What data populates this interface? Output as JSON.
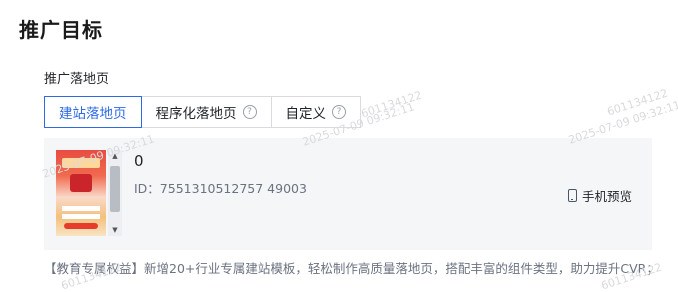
{
  "page": {
    "title": "推广目标"
  },
  "landing": {
    "label": "推广落地页",
    "tabs": [
      {
        "label": "建站落地页",
        "active": true,
        "help": false
      },
      {
        "label": "程序化落地页",
        "active": false,
        "help": true
      },
      {
        "label": "自定义",
        "active": false,
        "help": true
      }
    ],
    "selected": {
      "name": "0",
      "id_text": "ID：7551310512757 49003",
      "preview_label": "手机预览"
    },
    "description": "【教育专属权益】新增20+行业专属建站模板，轻松制作高质量落地页，搭配丰富的组件类型，助力提升CVR；"
  },
  "watermark": {
    "user": "601134122",
    "time": "2025-07-09 09:32:11"
  },
  "icons": {
    "help": "question-circle-icon",
    "phone": "mobile-phone-icon"
  },
  "colors": {
    "accent": "#2e6ae6",
    "card_bg": "#f5f6f8",
    "border": "#d9dbe0"
  }
}
